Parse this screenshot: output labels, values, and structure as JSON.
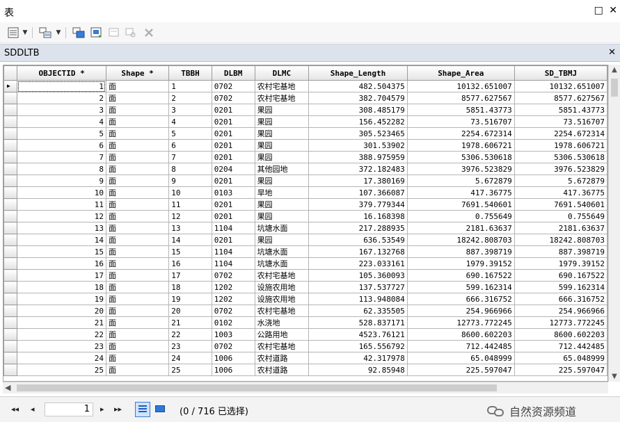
{
  "window": {
    "title": "表",
    "restore_glyph": "□",
    "close_glyph": "✕"
  },
  "toolbar": {
    "icons": [
      "table-options-icon",
      "related-tables-icon",
      "select-by-attributes-icon",
      "switch-selection-icon",
      "clear-selection-icon",
      "zoom-to-selected-icon",
      "delete-selected-icon"
    ]
  },
  "tab": {
    "name": "SDDLTB",
    "close_glyph": "✕"
  },
  "table": {
    "columns": [
      "OBJECTID *",
      "Shape *",
      "TBBH",
      "DLBM",
      "DLMC",
      "Shape_Length",
      "Shape_Area",
      "SD_TBMJ"
    ],
    "rows": [
      [
        "1",
        "面",
        "1",
        "0702",
        "农村宅基地",
        "482.504375",
        "10132.651007",
        "10132.651007"
      ],
      [
        "2",
        "面",
        "2",
        "0702",
        "农村宅基地",
        "382.704579",
        "8577.627567",
        "8577.627567"
      ],
      [
        "3",
        "面",
        "3",
        "0201",
        "果园",
        "308.485179",
        "5851.43773",
        "5851.43773"
      ],
      [
        "4",
        "面",
        "4",
        "0201",
        "果园",
        "156.452282",
        "73.516707",
        "73.516707"
      ],
      [
        "5",
        "面",
        "5",
        "0201",
        "果园",
        "305.523465",
        "2254.672314",
        "2254.672314"
      ],
      [
        "6",
        "面",
        "6",
        "0201",
        "果园",
        "301.53902",
        "1978.606721",
        "1978.606721"
      ],
      [
        "7",
        "面",
        "7",
        "0201",
        "果园",
        "388.975959",
        "5306.530618",
        "5306.530618"
      ],
      [
        "8",
        "面",
        "8",
        "0204",
        "其他园地",
        "372.182483",
        "3976.523829",
        "3976.523829"
      ],
      [
        "9",
        "面",
        "9",
        "0201",
        "果园",
        "17.380169",
        "5.672879",
        "5.672879"
      ],
      [
        "10",
        "面",
        "10",
        "0103",
        "旱地",
        "107.366087",
        "417.36775",
        "417.36775"
      ],
      [
        "11",
        "面",
        "11",
        "0201",
        "果园",
        "379.779344",
        "7691.540601",
        "7691.540601"
      ],
      [
        "12",
        "面",
        "12",
        "0201",
        "果园",
        "16.168398",
        "0.755649",
        "0.755649"
      ],
      [
        "13",
        "面",
        "13",
        "1104",
        "坑塘水面",
        "217.288935",
        "2181.63637",
        "2181.63637"
      ],
      [
        "14",
        "面",
        "14",
        "0201",
        "果园",
        "636.53549",
        "18242.808703",
        "18242.808703"
      ],
      [
        "15",
        "面",
        "15",
        "1104",
        "坑塘水面",
        "167.132768",
        "887.398719",
        "887.398719"
      ],
      [
        "16",
        "面",
        "16",
        "1104",
        "坑塘水面",
        "223.033161",
        "1979.39152",
        "1979.39152"
      ],
      [
        "17",
        "面",
        "17",
        "0702",
        "农村宅基地",
        "105.360093",
        "690.167522",
        "690.167522"
      ],
      [
        "18",
        "面",
        "18",
        "1202",
        "设施农用地",
        "137.537727",
        "599.162314",
        "599.162314"
      ],
      [
        "19",
        "面",
        "19",
        "1202",
        "设施农用地",
        "113.948084",
        "666.316752",
        "666.316752"
      ],
      [
        "20",
        "面",
        "20",
        "0702",
        "农村宅基地",
        "62.335505",
        "254.966966",
        "254.966966"
      ],
      [
        "21",
        "面",
        "21",
        "0102",
        "水浇地",
        "528.837171",
        "12773.772245",
        "12773.772245"
      ],
      [
        "22",
        "面",
        "22",
        "1003",
        "公路用地",
        "4523.76121",
        "8600.602203",
        "8600.602203"
      ],
      [
        "23",
        "面",
        "23",
        "0702",
        "农村宅基地",
        "165.556792",
        "712.442485",
        "712.442485"
      ],
      [
        "24",
        "面",
        "24",
        "1006",
        "农村道路",
        "42.317978",
        "65.048999",
        "65.048999"
      ],
      [
        "25",
        "面",
        "25",
        "1006",
        "农村道路",
        "92.85948",
        "225.597047",
        "225.597047"
      ]
    ]
  },
  "status": {
    "current_record": "1",
    "selection_text": "(0 / 716 已选择)",
    "nav": {
      "first": "◂◂",
      "prev": "◂",
      "next": "▸",
      "last": "▸▸"
    }
  },
  "watermark": {
    "text": "自然资源频道"
  }
}
